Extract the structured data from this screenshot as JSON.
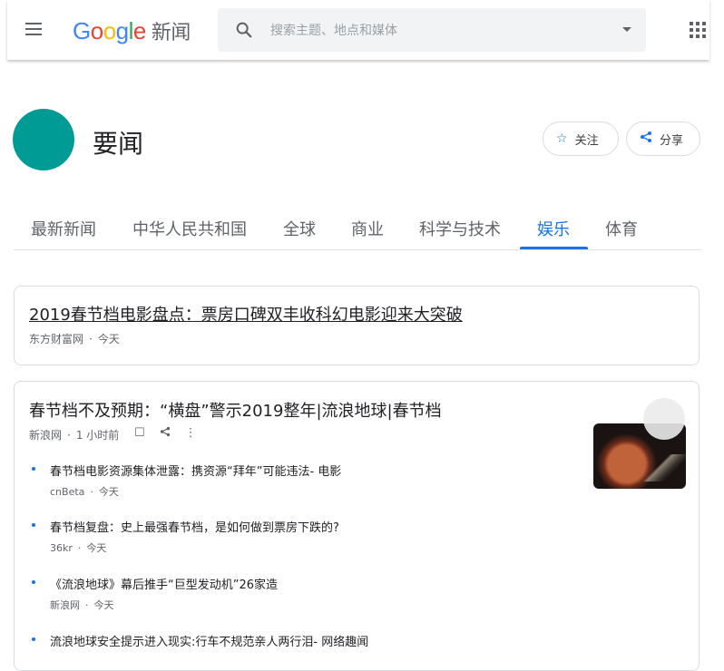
{
  "header": {
    "logo_word": "Google",
    "logo_suffix": "新闻",
    "search_placeholder": "搜索主题、地点和媒体"
  },
  "topic": {
    "title": "要闻",
    "follow_label": "关注",
    "share_label": "分享",
    "avatar_color": "#009b95"
  },
  "tabs": [
    {
      "label": "最新新闻",
      "active": false
    },
    {
      "label": "中华人民共和国",
      "active": false
    },
    {
      "label": "全球",
      "active": false
    },
    {
      "label": "商业",
      "active": false
    },
    {
      "label": "科学与技术",
      "active": false
    },
    {
      "label": "娱乐",
      "active": true
    },
    {
      "label": "体育",
      "active": false
    }
  ],
  "cards": [
    {
      "headline": "2019春节档电影盘点：票房口碑双丰收科幻电影迎来大突破",
      "source": "东方财富网",
      "time": "今天"
    },
    {
      "headline": "春节档不及预期：“横盘”警示2019整年|流浪地球|春节档",
      "source": "新浪网",
      "time": "1 小时前",
      "related": [
        {
          "title": "春节档电影资源集体泄露：携资源“拜年”可能违法- 电影",
          "source": "cnBeta",
          "time": "今天"
        },
        {
          "title": "春节档复盘：史上最强春节档，是如何做到票房下跌的?",
          "source": "36kr",
          "time": "今天"
        },
        {
          "title": "《流浪地球》幕后推手“巨型发动机”26家造",
          "source": "新浪网",
          "time": "今天"
        },
        {
          "title": "流浪地球安全提示进入现实:行车不规范亲人两行泪- 网络趣闻",
          "source": "",
          "time": ""
        }
      ]
    }
  ],
  "colors": {
    "accent": "#1a73e8",
    "text": "#202124",
    "meta": "#5f6368"
  }
}
